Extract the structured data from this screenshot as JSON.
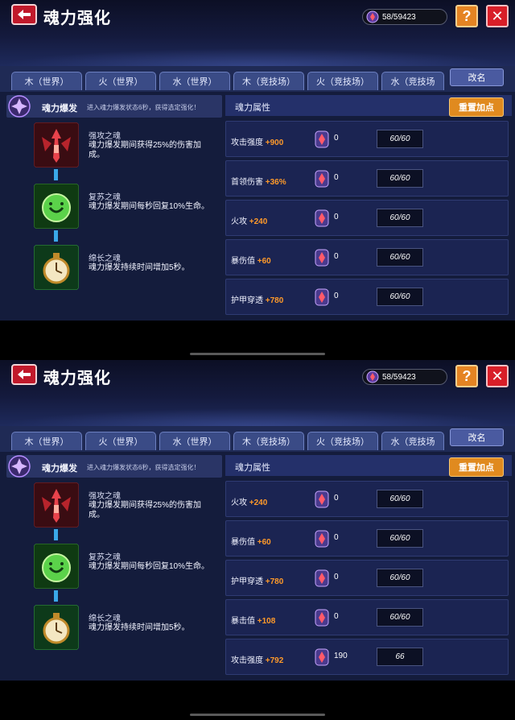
{
  "colors": {
    "accent_orange": "#ff9a2a",
    "close_red": "#d81e28",
    "help_orange": "#e58423",
    "link_blue": "#3aa8e8"
  },
  "screens": [
    {
      "title": "魂力强化",
      "currency": "58/59423",
      "help_label": "?",
      "close_label": "✕",
      "tabs": [
        "木（世界）",
        "火（世界）",
        "水（世界）",
        "木（竞技场）",
        "火（竞技场）",
        "水（竞技场"
      ],
      "rename_label": "改名",
      "burst": {
        "name": "魂力爆发",
        "desc": "进入魂力爆发状态6秒，获得选定强化！"
      },
      "souls": [
        {
          "name": "强攻之魂",
          "desc": "魂力爆发期间获得25%的伤害加成。",
          "icon": "attack-soul-icon"
        },
        {
          "name": "复苏之魂",
          "desc": "魂力爆发期间每秒回复10%生命。",
          "icon": "revive-soul-icon"
        },
        {
          "name": "绵长之魂",
          "desc": "魂力爆发持续时间增加5秒。",
          "icon": "duration-soul-icon"
        }
      ],
      "attr_title": "魂力属性",
      "reset_label": "重置加点",
      "attributes": [
        {
          "label": "攻击强度",
          "bonus": "+900",
          "count": "0",
          "box": "60/60"
        },
        {
          "label": "首领伤害",
          "bonus": "+36%",
          "count": "0",
          "box": "60/60"
        },
        {
          "label": "火攻",
          "bonus": "+240",
          "count": "0",
          "box": "60/60"
        },
        {
          "label": "暴伤值",
          "bonus": "+60",
          "count": "0",
          "box": "60/60"
        },
        {
          "label": "护甲穿透",
          "bonus": "+780",
          "count": "0",
          "box": "60/60"
        }
      ]
    },
    {
      "title": "魂力强化",
      "currency": "58/59423",
      "help_label": "?",
      "close_label": "✕",
      "tabs": [
        "木（世界）",
        "火（世界）",
        "水（世界）",
        "木（竞技场）",
        "火（竞技场）",
        "水（竞技场"
      ],
      "rename_label": "改名",
      "burst": {
        "name": "魂力爆发",
        "desc": "进入魂力爆发状态6秒，获得选定强化！"
      },
      "souls": [
        {
          "name": "强攻之魂",
          "desc": "魂力爆发期间获得25%的伤害加成。",
          "icon": "attack-soul-icon"
        },
        {
          "name": "复苏之魂",
          "desc": "魂力爆发期间每秒回复10%生命。",
          "icon": "revive-soul-icon"
        },
        {
          "name": "绵长之魂",
          "desc": "魂力爆发持续时间增加5秒。",
          "icon": "duration-soul-icon"
        }
      ],
      "attr_title": "魂力属性",
      "reset_label": "重置加点",
      "attributes": [
        {
          "label": "火攻",
          "bonus": "+240",
          "count": "0",
          "box": "60/60"
        },
        {
          "label": "暴伤值",
          "bonus": "+60",
          "count": "0",
          "box": "60/60"
        },
        {
          "label": "护甲穿透",
          "bonus": "+780",
          "count": "0",
          "box": "60/60"
        },
        {
          "label": "暴击值",
          "bonus": "+108",
          "count": "0",
          "box": "60/60"
        },
        {
          "label": "攻击强度",
          "bonus": "+792",
          "count": "190",
          "box": "66"
        }
      ]
    }
  ]
}
